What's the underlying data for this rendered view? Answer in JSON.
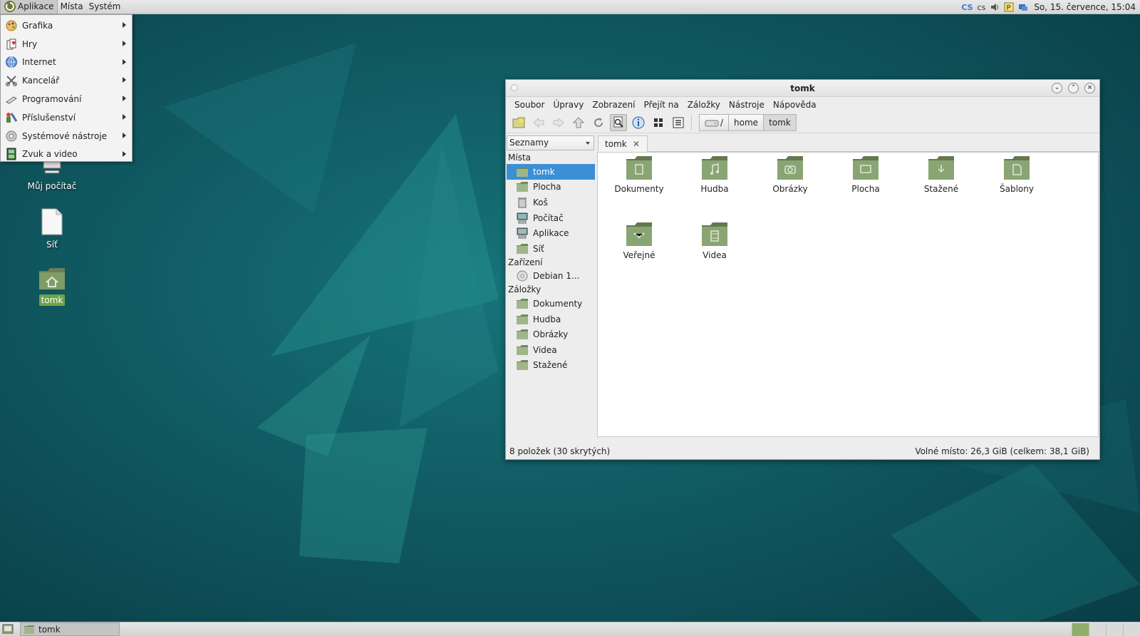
{
  "top_panel": {
    "menus": [
      "Aplikace",
      "Místa",
      "Systém"
    ],
    "tray_lang_code": "CS",
    "tray_lang": "cs",
    "clock": "So, 15. července, 15:04"
  },
  "app_menu": {
    "items": [
      {
        "label": "Grafika",
        "icon": "graphics-icon"
      },
      {
        "label": "Hry",
        "icon": "games-icon"
      },
      {
        "label": "Internet",
        "icon": "internet-icon"
      },
      {
        "label": "Kancelář",
        "icon": "office-icon"
      },
      {
        "label": "Programování",
        "icon": "programming-icon"
      },
      {
        "label": "Příslušenství",
        "icon": "accessories-icon"
      },
      {
        "label": "Systémové nástroje",
        "icon": "system-tools-icon"
      },
      {
        "label": "Zvuk a video",
        "icon": "sound-video-icon"
      }
    ]
  },
  "desktop": {
    "icons": [
      {
        "label": "Můj počítač",
        "icon": "computer-icon"
      },
      {
        "label": "Síť",
        "icon": "network-icon"
      },
      {
        "label": "tomk",
        "icon": "home-folder-icon"
      }
    ]
  },
  "window": {
    "title": "tomk",
    "menubar": [
      "Soubor",
      "Úpravy",
      "Zobrazení",
      "Přejít na",
      "Záložky",
      "Nástroje",
      "Nápověda"
    ],
    "path": {
      "root": "/",
      "segments": [
        "home",
        "tomk"
      ]
    },
    "side_combo": "Seznamy",
    "sidebar": {
      "places_header": "Místa",
      "places": [
        "tomk",
        "Plocha",
        "Koš",
        "Počítač",
        "Aplikace",
        "Síť"
      ],
      "devices_header": "Zařízení",
      "devices": [
        "Debian 1..."
      ],
      "bookmarks_header": "Záložky",
      "bookmarks": [
        "Dokumenty",
        "Hudba",
        "Obrázky",
        "Videa",
        "Stažené"
      ]
    },
    "tab": {
      "label": "tomk",
      "close": "✕"
    },
    "files": [
      "Dokumenty",
      "Hudba",
      "Obrázky",
      "Plocha",
      "Stažené",
      "Šablony",
      "Veřejné",
      "Videa"
    ],
    "status_left": "8 položek (30 skrytých)",
    "status_right": "Volné místo: 26,3 GiB (celkem: 38,1 GiB)"
  },
  "bottom_panel": {
    "task": "tomk"
  },
  "colors": {
    "desktop": "#0b5358",
    "selection": "#3b8fd6",
    "folder": "#7f9c66"
  }
}
